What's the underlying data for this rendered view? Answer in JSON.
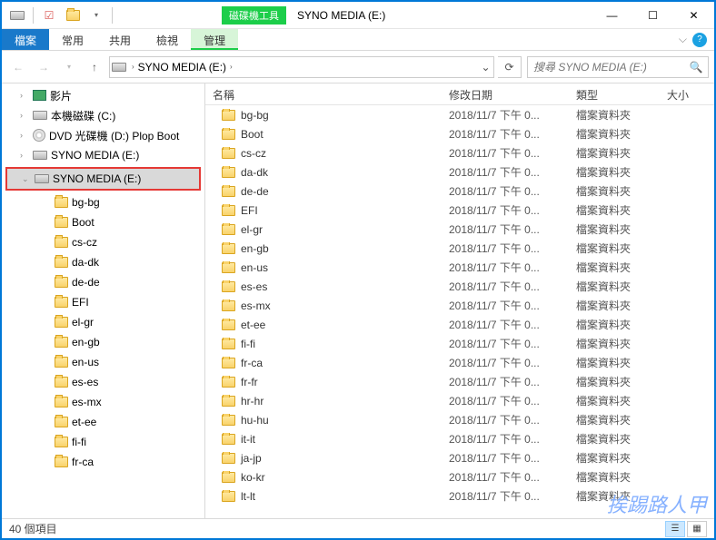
{
  "window": {
    "title": "SYNO MEDIA (E:)",
    "context_tab_group": "磁碟機工具"
  },
  "ribbon": {
    "file": "檔案",
    "tabs": [
      "常用",
      "共用",
      "檢視"
    ],
    "context_tab": "管理"
  },
  "nav": {
    "breadcrumb": "SYNO MEDIA (E:)",
    "search_placeholder": "搜尋 SYNO MEDIA (E:)"
  },
  "tree": [
    {
      "depth": 1,
      "icon": "vid",
      "label": "影片"
    },
    {
      "depth": 1,
      "icon": "drive",
      "label": "本機磁碟 (C:)"
    },
    {
      "depth": 1,
      "icon": "disc",
      "label": "DVD 光碟機 (D:) Plop Boot"
    },
    {
      "depth": 1,
      "icon": "drive",
      "label": "SYNO MEDIA (E:)"
    },
    {
      "depth": 0,
      "icon": "drive",
      "label": "SYNO MEDIA (E:)",
      "selected": true,
      "highlighted": true,
      "chev": true
    },
    {
      "depth": 2,
      "icon": "folder",
      "label": "bg-bg"
    },
    {
      "depth": 2,
      "icon": "folder",
      "label": "Boot"
    },
    {
      "depth": 2,
      "icon": "folder",
      "label": "cs-cz"
    },
    {
      "depth": 2,
      "icon": "folder",
      "label": "da-dk"
    },
    {
      "depth": 2,
      "icon": "folder",
      "label": "de-de"
    },
    {
      "depth": 2,
      "icon": "folder",
      "label": "EFI"
    },
    {
      "depth": 2,
      "icon": "folder",
      "label": "el-gr"
    },
    {
      "depth": 2,
      "icon": "folder",
      "label": "en-gb"
    },
    {
      "depth": 2,
      "icon": "folder",
      "label": "en-us"
    },
    {
      "depth": 2,
      "icon": "folder",
      "label": "es-es"
    },
    {
      "depth": 2,
      "icon": "folder",
      "label": "es-mx"
    },
    {
      "depth": 2,
      "icon": "folder",
      "label": "et-ee"
    },
    {
      "depth": 2,
      "icon": "folder",
      "label": "fi-fi"
    },
    {
      "depth": 2,
      "icon": "folder",
      "label": "fr-ca"
    }
  ],
  "columns": {
    "name": "名稱",
    "date": "修改日期",
    "type": "類型",
    "size": "大小"
  },
  "type_label": "檔案資料夾",
  "date_label": "2018/11/7 下午 0...",
  "files": [
    "bg-bg",
    "Boot",
    "cs-cz",
    "da-dk",
    "de-de",
    "EFI",
    "el-gr",
    "en-gb",
    "en-us",
    "es-es",
    "es-mx",
    "et-ee",
    "fi-fi",
    "fr-ca",
    "fr-fr",
    "hr-hr",
    "hu-hu",
    "it-it",
    "ja-jp",
    "ko-kr",
    "lt-lt"
  ],
  "status": {
    "count": "40 個項目"
  },
  "watermark": "挨踢路人甲"
}
